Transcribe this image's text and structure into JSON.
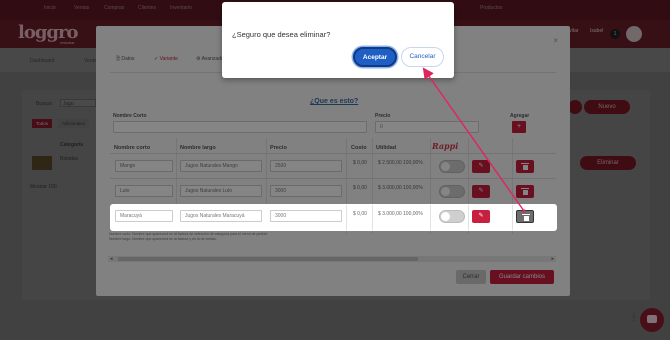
{
  "app": {
    "logo": "loggro",
    "logo_sub": "restobar",
    "top_nav": [
      "Inicio",
      "Ventas",
      "Compras",
      "Clientes",
      "Inventario",
      "Productos"
    ],
    "user_label": "Isabel",
    "user_prefix": "Invitar",
    "notif_count": "1",
    "subnav": [
      "Dashboard",
      "Ventas"
    ],
    "bg_search_label": "Buscar:",
    "bg_search_value": "Jugo",
    "bg_tabs": [
      "Todos",
      "Adicionales"
    ],
    "bg_category_label": "Categoría",
    "bg_item": "Bebidas",
    "bg_mostrar": "Mostrar 100",
    "bg_new_button": "Nuevo",
    "bg_delete_button": "Eliminar"
  },
  "modal": {
    "tabs": [
      {
        "label": "Datos",
        "icon": "file-icon"
      },
      {
        "label": "Variante",
        "icon": "check-icon"
      },
      {
        "label": "Avanzado",
        "icon": "gear-icon"
      }
    ],
    "close_glyph": "×",
    "help_link": "¿Que es esto?",
    "labels": {
      "short_name": "Nombre Corto",
      "price": "Precio",
      "add": "Agregar"
    },
    "price_placeholder": "0",
    "add_glyph": "+",
    "table": {
      "headers": [
        "Nombre corto",
        "Nombre largo",
        "Precio",
        "Costo",
        "Utilidad",
        "Rappi"
      ],
      "rows": [
        {
          "short": "Mango",
          "long": "Jugos Naturales Mango",
          "price": "2500",
          "cost": "$ 0,00",
          "utility": "$ 2.500,00 100,00%"
        },
        {
          "short": "Lulo",
          "long": "Jugos Naturales Lulo",
          "price": "3000",
          "cost": "$ 0,00",
          "utility": "$ 3.000,00 100,00%"
        },
        {
          "short": "Maracuyá",
          "long": "Jugos Naturales Maracuyá",
          "price": "3000",
          "cost": "$ 0,00",
          "utility": "$ 3.000,00 100,00%"
        }
      ]
    },
    "notes": [
      "Nombre corto: Nombre que aparecerá en la factura de selección de categoría para el menú de pedido.",
      "Nombre largo: Nombre que aparecerá en la factura y en la de ventas."
    ],
    "buttons": {
      "close": "Cerrar",
      "save": "Guardar cambios"
    }
  },
  "confirm": {
    "message": "¿Seguro que desea eliminar?",
    "accept": "Aceptar",
    "cancel": "Cancelar"
  },
  "colors": {
    "accent": "#c91f3f",
    "dialog_primary": "#1f5fc4",
    "brand_dark": "#6a1f2b"
  }
}
